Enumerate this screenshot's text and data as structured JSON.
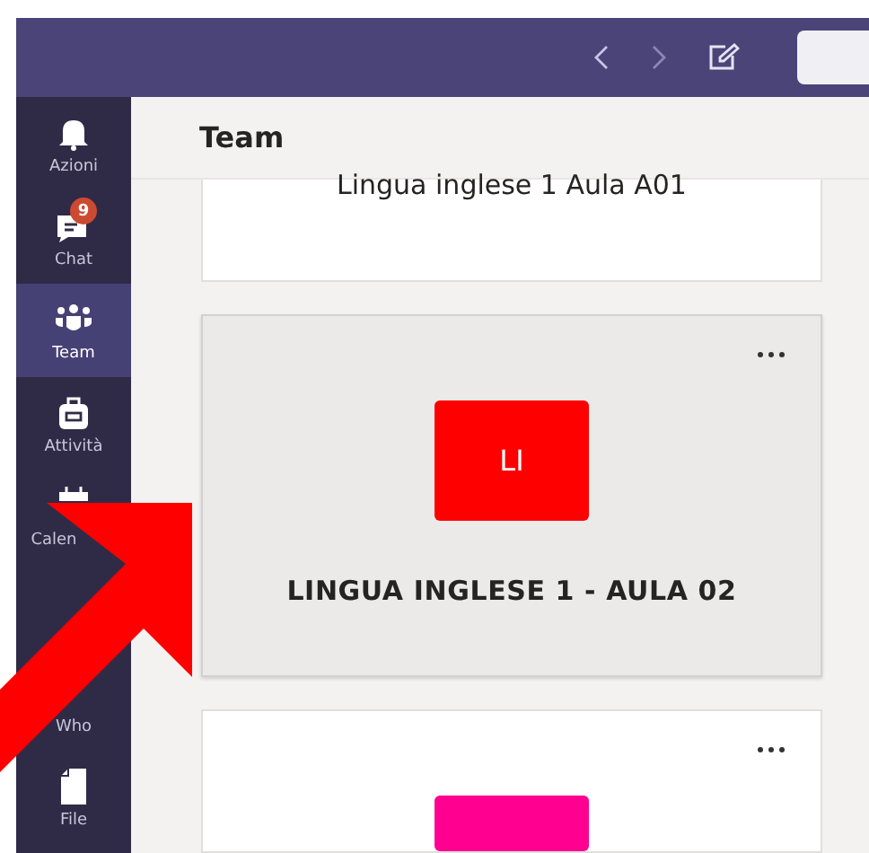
{
  "sidebar": {
    "items": [
      {
        "label": "Azioni",
        "selected": false
      },
      {
        "label": "Chat",
        "selected": false,
        "badge": "9"
      },
      {
        "label": "Team",
        "selected": true
      },
      {
        "label": "Attività",
        "selected": false
      },
      {
        "label": "Calen",
        "selected": false
      },
      {
        "label": "Who",
        "selected": false
      },
      {
        "label": "File",
        "selected": false
      }
    ]
  },
  "header": {
    "title": "Team"
  },
  "teams": [
    {
      "name": "Lingua inglese 1 Aula A01",
      "selected": false
    },
    {
      "name": "LINGUA INGLESE 1 - AULA 02",
      "initials": "LI",
      "color": "#ff0000",
      "selected": true
    },
    {
      "color": "#ff0090",
      "selected": false
    }
  ]
}
